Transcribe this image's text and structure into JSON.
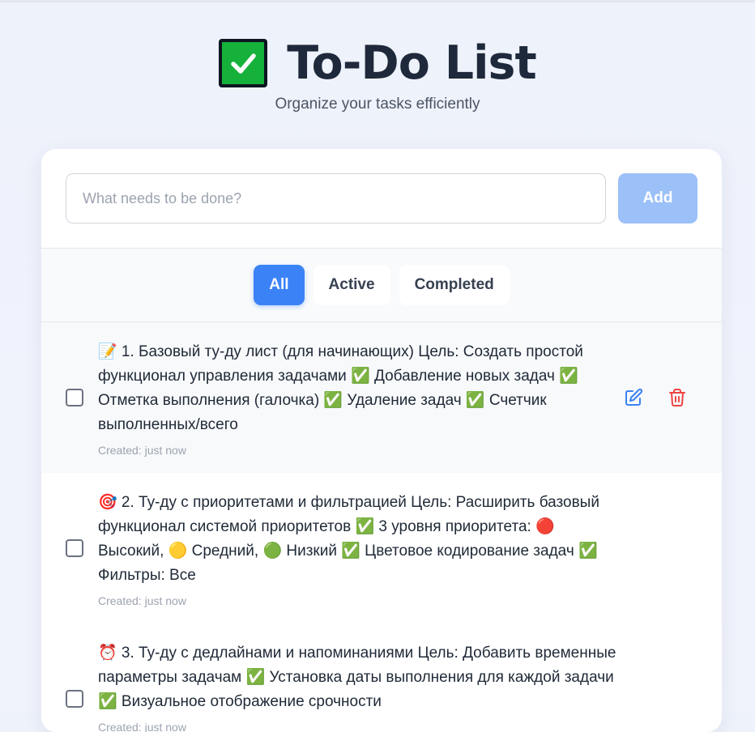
{
  "app": {
    "title": "To-Do List",
    "title_icon": "check-box-icon",
    "subtitle": "Organize your tasks efficiently"
  },
  "input": {
    "placeholder": "What needs to be done?",
    "value": "",
    "add_label": "Add"
  },
  "filters": [
    {
      "label": "All",
      "active": true
    },
    {
      "label": "Active",
      "active": false
    },
    {
      "label": "Completed",
      "active": false
    }
  ],
  "tasks": [
    {
      "text": "📝 1. Базовый ту-ду лист (для начинающих) Цель: Создать простой функционал управления задачами ✅ Добавление новых задач ✅ Отметка выполнения (галочка) ✅ Удаление задач ✅ Счетчик выполненных/всего",
      "meta": "Created: just now",
      "completed": false,
      "show_actions": true
    },
    {
      "text": "🎯 2. Ту-ду с приоритетами и фильтрацией Цель: Расширить базовый функционал системой приоритетов ✅ 3 уровня приоритета: 🔴 Высокий, 🟡 Средний, 🟢 Низкий ✅ Цветовое кодирование задач ✅ Фильтры: Все",
      "meta": "Created: just now",
      "completed": false,
      "show_actions": false
    },
    {
      "text": "⏰ 3. Ту-ду с дедлайнами и напоминаниями Цель: Добавить временные параметры задачам ✅ Установка даты выполнения для каждой задачи ✅ Визуальное отображение срочности",
      "meta": "Created: just now",
      "completed": false,
      "show_actions": false
    }
  ],
  "colors": {
    "accent": "#3b82f6",
    "add_button": "#9cc0f8",
    "edit_icon": "#3b82f6",
    "delete_icon": "#ef4444",
    "check_green": "#16b13a"
  }
}
